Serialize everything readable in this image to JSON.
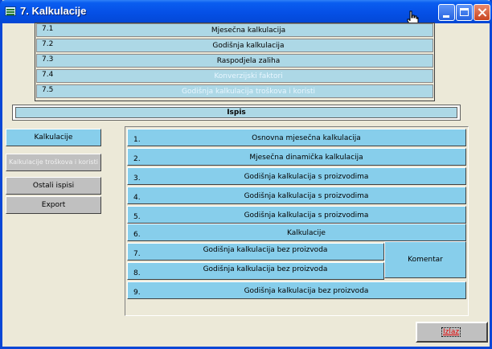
{
  "window": {
    "title": "7. Kalkulacije"
  },
  "menu": [
    {
      "num": "7.1",
      "label": "Mjesečna kalkulacija",
      "enabled": true
    },
    {
      "num": "7.2",
      "label": "Godišnja kalkulacija",
      "enabled": true
    },
    {
      "num": "7.3",
      "label": "Raspodjela zaliha",
      "enabled": true
    },
    {
      "num": "7.4",
      "label": "Konverzijski faktori",
      "enabled": false
    },
    {
      "num": "7.5",
      "label": "Godišnja kalkulacija troškova i koristi",
      "enabled": false
    }
  ],
  "section_header": "Ispis",
  "side_buttons": [
    {
      "label": "Kalkulacije",
      "state": "active"
    },
    {
      "label": "Kalkulacije troškova i koristi",
      "state": "disabled"
    },
    {
      "label": "Ostali ispisi",
      "state": "normal"
    },
    {
      "label": "Export",
      "state": "normal"
    }
  ],
  "reports": [
    {
      "num": "1.",
      "label": "Osnovna mjesečna kalkulacija"
    },
    {
      "num": "2.",
      "label": "Mjesečna dinamička kalkulacija"
    },
    {
      "num": "3.",
      "label": "Godišnja kalkulacija s proizvodima"
    },
    {
      "num": "4.",
      "label": "Godišnja kalkulacija s proizvodima"
    },
    {
      "num": "5.",
      "label": "Godišnja kalkulacija s proizvodima"
    },
    {
      "num": "6.",
      "label": "Kalkulacije"
    },
    {
      "num": "7.",
      "label": "Godišnja kalkulacija bez proizvoda"
    },
    {
      "num": "8.",
      "label": "Godišnja kalkulacija bez proizvoda"
    },
    {
      "num": "9.",
      "label": "Godišnja kalkulacija bez proizvoda"
    }
  ],
  "komentar_label": "Komentar",
  "exit_label": "Izlaz",
  "colors": {
    "title_bar": "#0550e6",
    "row_light_blue": "#add8e6",
    "button_sky_blue": "#87ceeb",
    "exit_text": "#e00000"
  }
}
